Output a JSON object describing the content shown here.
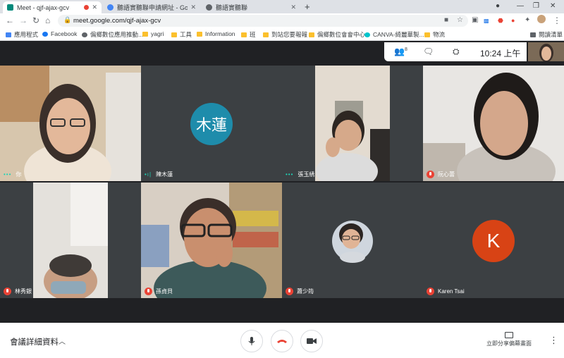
{
  "tabs": [
    {
      "title": "Meet - qjf-ajax-gcv",
      "active": true,
      "recording": true
    },
    {
      "title": "聽語實聽聯申請網址 - Google 雲",
      "active": false
    },
    {
      "title": "聽語實聽聯",
      "active": false
    }
  ],
  "browser": {
    "url": "meet.google.com/qjf-ajax-gcv",
    "reading_list": "閱讀清單"
  },
  "bookmarks": [
    {
      "label": "應用程式",
      "icon": "grid-icon"
    },
    {
      "label": "Facebook",
      "icon": "facebook-icon"
    },
    {
      "label": "偏鄉數位應用推動...",
      "icon": "person-icon"
    },
    {
      "label": "yagri",
      "icon": "folder-icon"
    },
    {
      "label": "工具",
      "icon": "folder-icon"
    },
    {
      "label": "Information",
      "icon": "folder-icon"
    },
    {
      "label": "班",
      "icon": "folder-icon"
    },
    {
      "label": "到站您要報報",
      "icon": "folder-icon"
    },
    {
      "label": "偏鄉數位會會中心",
      "icon": "folder-icon"
    },
    {
      "label": "CANVA-綺麗華製...",
      "icon": "canva-icon"
    },
    {
      "label": "物流",
      "icon": "folder-icon"
    }
  ],
  "meet": {
    "time": "10:24 上午",
    "participants_badge": "8",
    "participants": [
      {
        "name": "你",
        "muted": false,
        "speaking_dots": "•••",
        "type": "video"
      },
      {
        "name": "陳木蓮",
        "muted": false,
        "speaking_dots": "•ı|",
        "type": "avatar",
        "initials": "木蓮",
        "color": "#1e8cab"
      },
      {
        "name": "張玉綉",
        "muted": false,
        "speaking_dots": "•••",
        "type": "video"
      },
      {
        "name": "阮心蕾",
        "muted": true,
        "type": "video"
      },
      {
        "name": "林秀銀",
        "muted": true,
        "type": "video"
      },
      {
        "name": "孫貞貝",
        "muted": true,
        "type": "video"
      },
      {
        "name": "蕭少筠",
        "muted": true,
        "type": "small-video"
      },
      {
        "name": "Karen Tsai",
        "muted": true,
        "type": "avatar",
        "initials": "K",
        "color": "#d84315"
      }
    ]
  },
  "bottom": {
    "meeting_details": "會議詳細資料",
    "present_now": "立即分享偏幕畫面"
  }
}
